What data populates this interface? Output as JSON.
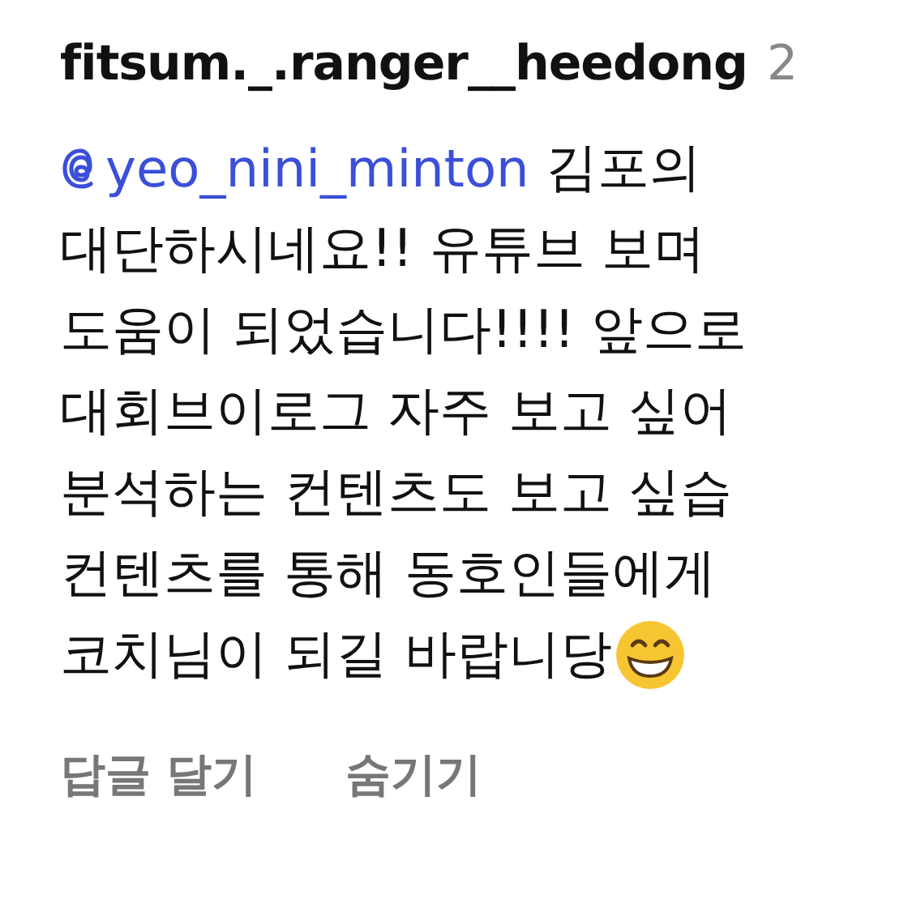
{
  "comment": {
    "author": "fitsum._.ranger__heedong",
    "time": "2",
    "mention": "yeo_nini_minton",
    "lines": [
      "김포의",
      "대단하시네요!! 유튜브 보며",
      "도움이 되었습니다!!!! 앞으로",
      "대회브이로그 자주 보고 싶어",
      "분석하는 컨텐츠도 보고 싶습",
      "컨텐츠를 통해 동호인들에게",
      "코치님이 되길 바랍니당"
    ],
    "ends_with_emoji": true
  },
  "actions": [
    "답글 달기",
    "숨기기"
  ]
}
